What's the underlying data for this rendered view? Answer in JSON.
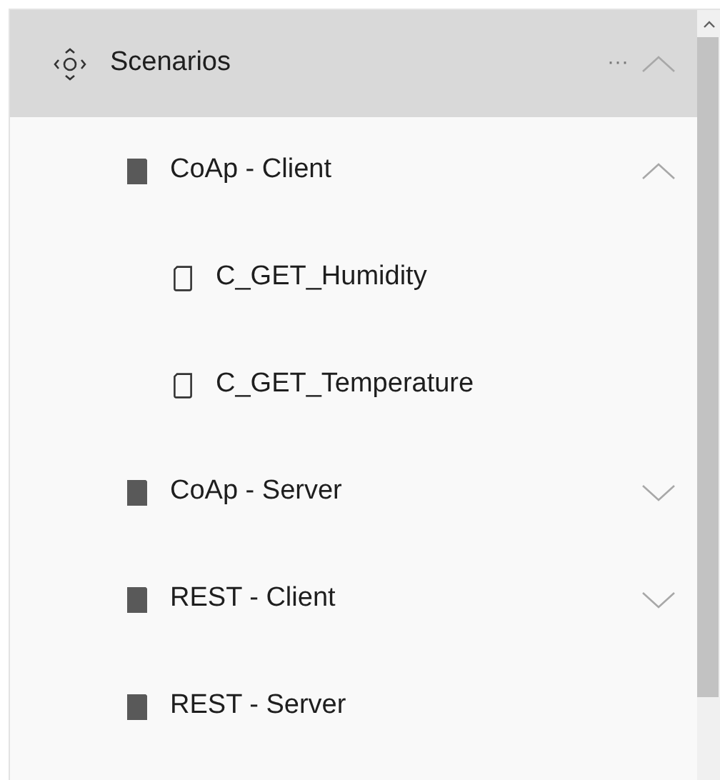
{
  "header": {
    "title": "Scenarios",
    "more": "···",
    "expanded": true
  },
  "items": [
    {
      "label": "CoAp - Client",
      "kind": "folder",
      "expanded": true,
      "children": [
        {
          "label": "C_GET_Humidity",
          "kind": "scenario"
        },
        {
          "label": "C_GET_Temperature",
          "kind": "scenario"
        }
      ]
    },
    {
      "label": "CoAp - Server",
      "kind": "folder",
      "expanded": false
    },
    {
      "label": "REST - Client",
      "kind": "folder",
      "expanded": false
    },
    {
      "label": "REST - Server",
      "kind": "folder"
    }
  ]
}
